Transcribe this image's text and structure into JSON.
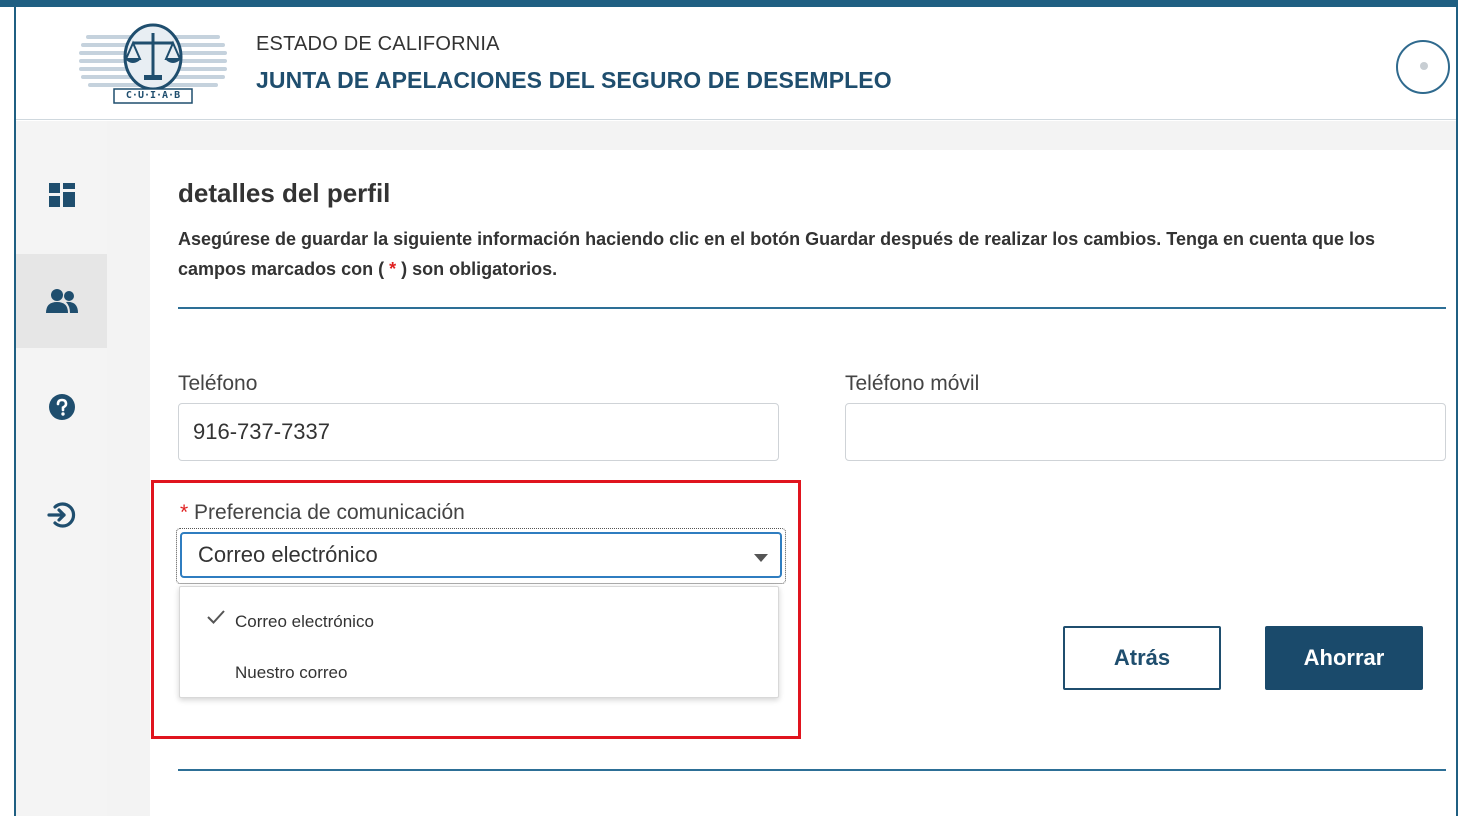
{
  "header": {
    "logo_text": "C·U·I·A·B",
    "supertitle": "ESTADO DE CALIFORNIA",
    "title": "JUNTA DE APELACIONES DEL SEGURO DE DESEMPLEO"
  },
  "sidebar": {
    "items": [
      {
        "icon": "dashboard-icon",
        "active": false
      },
      {
        "icon": "users-icon",
        "active": true
      },
      {
        "icon": "help-icon",
        "active": false
      },
      {
        "icon": "logout-icon",
        "active": false
      }
    ]
  },
  "profile": {
    "title": "detalles del perfil",
    "desc_before_star": "Asegúrese de guardar la siguiente información haciendo clic en el botón Guardar después de realizar los cambios. Tenga en cuenta que los campos marcados con (",
    "star": "*",
    "desc_after_star": ") son obligatorios.",
    "phone_label": "Teléfono",
    "phone_value": "916-737-7337",
    "mobile_label": "Teléfono móvil",
    "mobile_value": "",
    "comm_required": "*",
    "comm_label": "Preferencia de comunicación",
    "comm_selected": "Correo electrónico",
    "comm_options": [
      {
        "label": "Correo electrónico",
        "checked": true
      },
      {
        "label": "Nuestro correo",
        "checked": false
      }
    ],
    "back_label": "Atrás",
    "save_label": "Ahorrar"
  },
  "colors": {
    "brand": "#1f5f82",
    "primary_button": "#1a4a6b",
    "highlight": "#e0141e",
    "required": "#e02020"
  }
}
